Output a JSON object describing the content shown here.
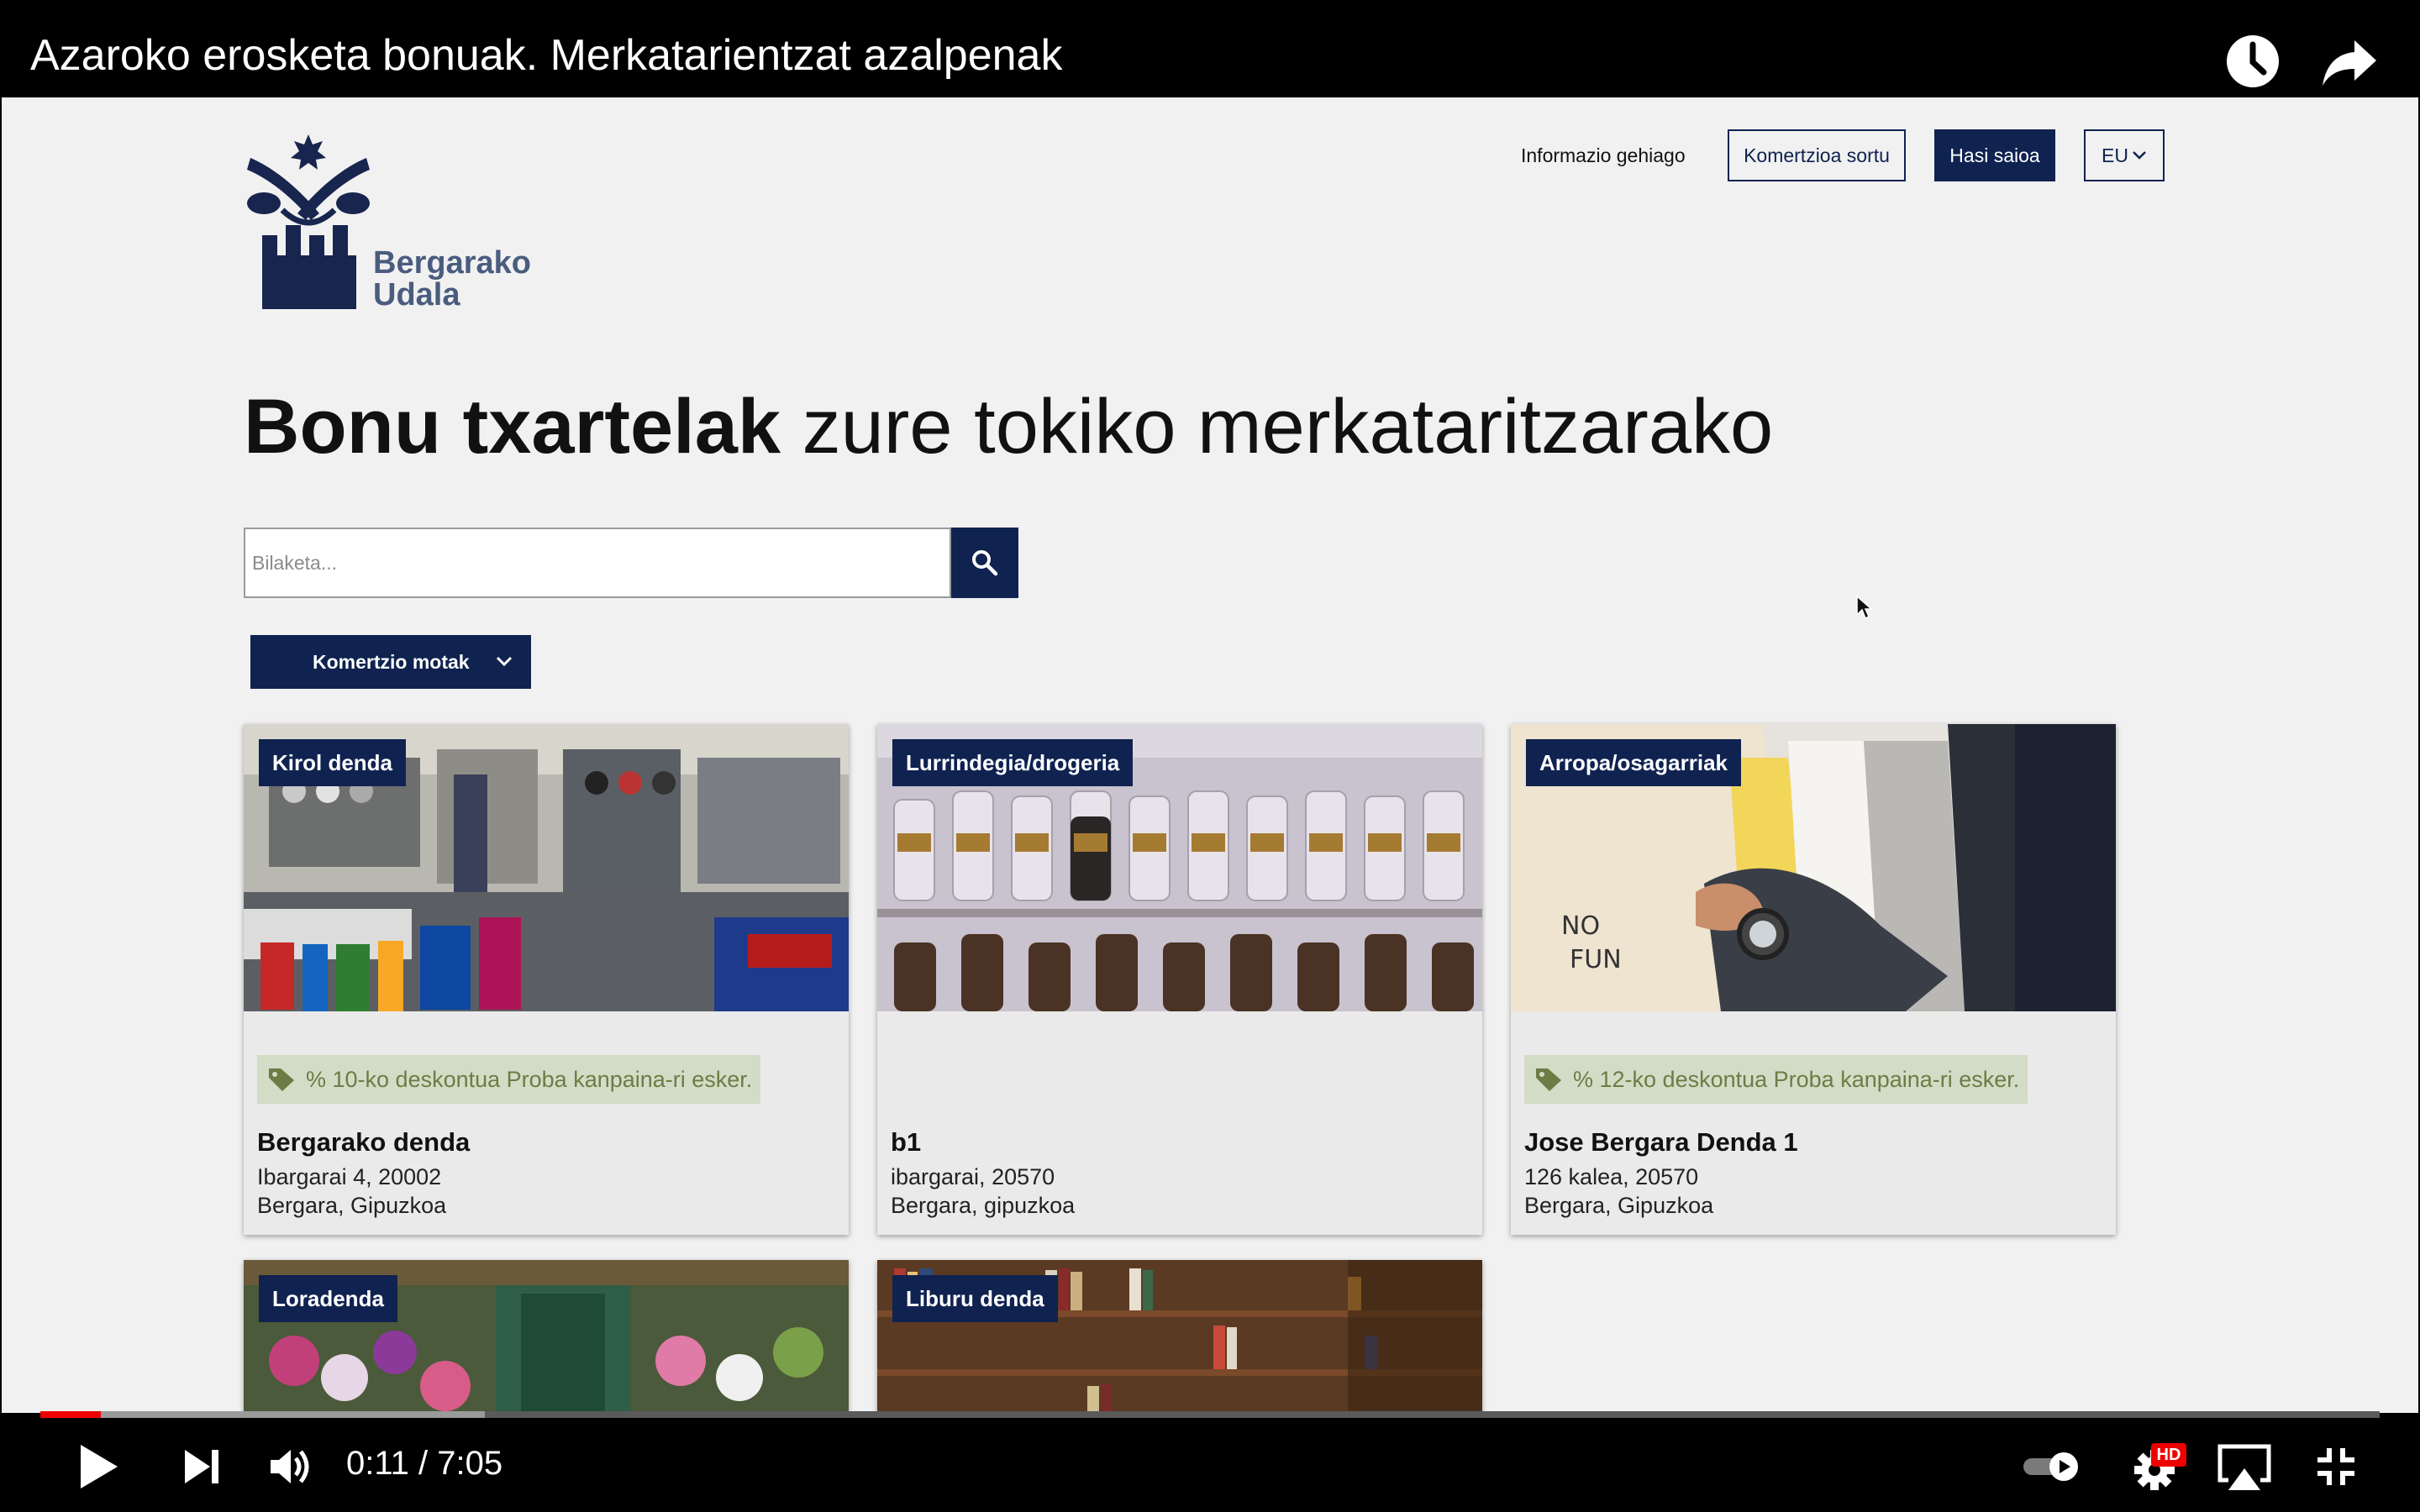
{
  "video": {
    "title": "Azaroko erosketa bonuak. Merkatarientzat azalpenak",
    "time": "0:11 / 7:05",
    "progress_fraction": 0.026,
    "buffered_fraction": 0.19,
    "icons": {
      "watch_later": "clock-icon",
      "share": "share-arrow-icon",
      "play": "play-icon",
      "next": "skip-next-icon",
      "volume": "volume-icon",
      "autoplay": "autoplay-toggle-icon",
      "settings": "gear-icon",
      "airplay": "airplay-icon",
      "exit_fullscreen": "exit-fullscreen-icon"
    },
    "settings_badge": "HD"
  },
  "site": {
    "logo": {
      "line1": "Bergarako",
      "line2": "Udala"
    },
    "nav": {
      "info": "Informazio gehiago",
      "create_shop": "Komertzioa sortu",
      "login": "Hasi saioa",
      "lang": "EU"
    },
    "hero": {
      "bold": "Bonu txartelak",
      "rest": " zure tokiko merkataritzarako"
    },
    "search": {
      "placeholder": "Bilaketa..."
    },
    "filter": {
      "label": "Komertzio motak"
    },
    "cards": [
      {
        "category": "Kirol denda",
        "discount": "% 10-ko deskontua Proba kanpaina-ri esker.",
        "name": "Bergarako denda",
        "addr1": "Ibargarai 4, 20002",
        "addr2": "Bergara, Gipuzkoa"
      },
      {
        "category": "Lurrindegia/drogeria",
        "discount": "",
        "name": "b1",
        "addr1": "ibargarai, 20570",
        "addr2": "Bergara, gipuzkoa"
      },
      {
        "category": "Arropa/osagarriak",
        "discount": "% 12-ko deskontua Proba kanpaina-ri esker.",
        "name": "Jose Bergara Denda 1",
        "addr1": "126 kalea, 20570",
        "addr2": "Bergara, Gipuzkoa"
      },
      {
        "category": "Loradenda"
      },
      {
        "category": "Liburu denda"
      }
    ],
    "colors": {
      "brand": "#0f2250",
      "discount_bg": "#d3dcc6",
      "discount_text": "#6b7d45"
    }
  }
}
